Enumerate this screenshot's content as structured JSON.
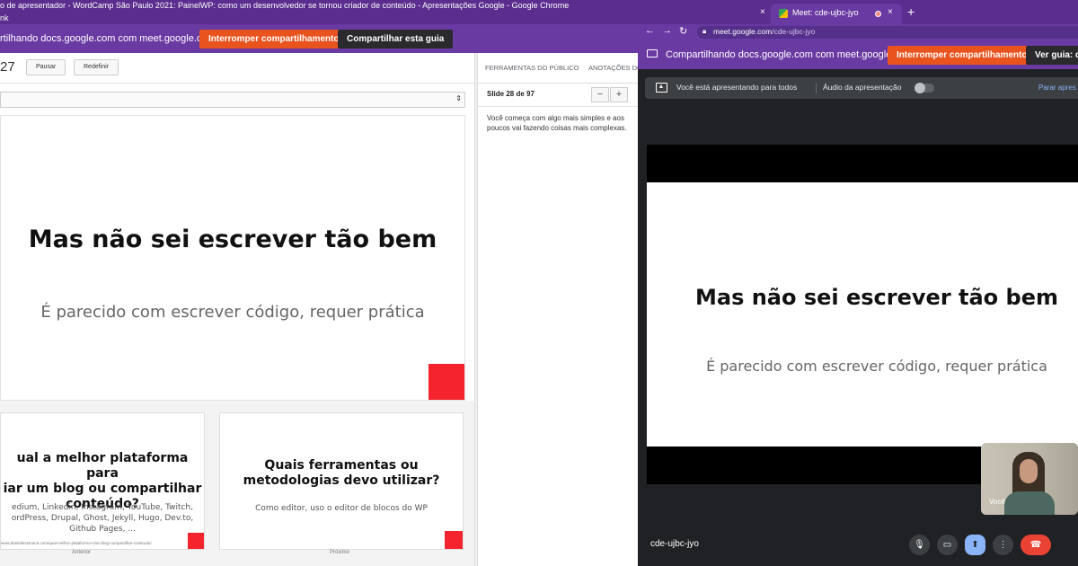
{
  "left_window": {
    "title": "o de apresentador - WordCamp São Paulo 2021: PainelWP: como um desenvolvedor se tornou criador de conteúdo - Apresentações Google - Google Chrome",
    "subtitle": "nk",
    "share_message": "rtilhando docs.google.com com meet.google.com",
    "stop_button": "Interromper compartilhamento",
    "share_tab_button": "Compartilhar esta guia",
    "timer": "27",
    "pause_button": "Pausar",
    "reset_button": "Redefinir",
    "select_arrows": "⇕",
    "current_slide": {
      "title": "Mas não sei escrever tão bem",
      "subtitle": "É parecido com escrever código, requer prática"
    },
    "prev_slide": {
      "title": "ual a melhor plataforma para\niar um blog ou compartilhar\nconteúdo?",
      "text": "edium, Linkedin, Instagram, YouTube, Twitch,\nordPress, Drupal, Ghost, Jekyll, Hugo, Dev.to,\nGithub Pages, ...",
      "url": "www.danieltessmann.com/qual-melhor-plataforma-criar-blog-compartilhar-conteudo/",
      "label": "Anterior"
    },
    "next_slide": {
      "title": "Quais ferramentas ou\nmetodologias devo utilizar?",
      "text": "Como editor, uso o editor de blocos do WP",
      "label": "Próximo"
    },
    "notes_panel": {
      "tab_audience": "FERRAMENTAS DO PÚBLICO",
      "tab_notes": "ANOTAÇÕES DO",
      "slide_counter": "Slide 28 de 97",
      "zoom_out": "−",
      "zoom_in": "+",
      "notes": "Você começa com algo mais simples e aos poucos vai fazendo coisas mais complexas."
    }
  },
  "right_window": {
    "tab_close_inactive": "×",
    "tab_title": "Meet: cde-ujbc-jyo",
    "tab_close": "×",
    "new_tab": "+",
    "nav_back": "←",
    "nav_forward": "→",
    "nav_reload": "↻",
    "url_host": "meet.google.com",
    "url_path": "/cde-ujbc-jyo",
    "share_message": "Compartilhando docs.google.com com meet.google.com",
    "stop_button": "Interromper compartilhamento",
    "view_tab_button": "Ver guia: do",
    "presenting_text": "Você está apresentando para todos",
    "audio_text": "Áudio da apresentação",
    "stop_present_link": "Parar apres",
    "slide": {
      "title": "Mas não sei escrever tão bem",
      "subtitle": "É parecido com escrever código, requer prática"
    },
    "self_name": "Você",
    "meeting_code": "cde-ujbc-jyo",
    "controls": {
      "mic": "🎙",
      "camera": "▭",
      "present": "⬆",
      "more": "⋮",
      "hangup": "☎"
    }
  },
  "colors": {
    "chrome_purple": "#5b2d8e",
    "share_bar": "#6a3aa3",
    "stop_orange": "#e8531e",
    "accent_red": "#f5232d",
    "meet_bg": "#202124",
    "hangup_red": "#ea4335",
    "present_blue": "#8ab4f8"
  }
}
